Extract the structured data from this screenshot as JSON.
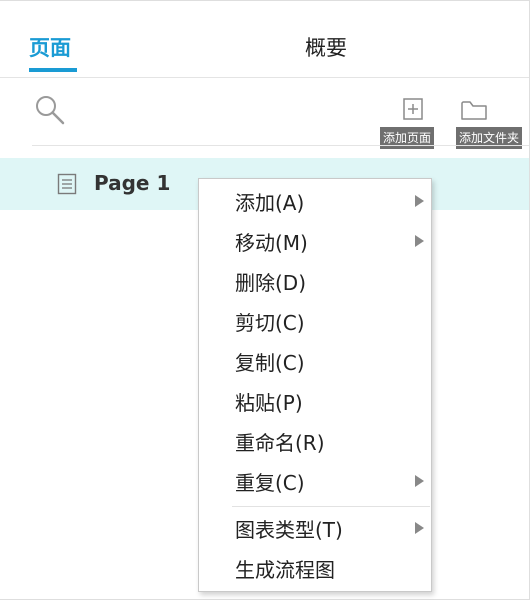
{
  "tabs": {
    "pages": "页面",
    "outline": "概要"
  },
  "toolbar": {
    "search_icon": "search-icon",
    "add_page_tooltip": "添加页面",
    "add_folder_tooltip": "添加文件夹"
  },
  "tree": {
    "items": [
      {
        "label": "Page 1",
        "icon": "page-icon",
        "selected": true
      }
    ]
  },
  "context_menu": {
    "items": [
      {
        "label": "添加(A)",
        "submenu": true
      },
      {
        "label": "移动(M)",
        "submenu": true
      },
      {
        "label": "删除(D)",
        "submenu": false
      },
      {
        "label": "剪切(C)",
        "submenu": false
      },
      {
        "label": "复制(C)",
        "submenu": false
      },
      {
        "label": "粘贴(P)",
        "submenu": false
      },
      {
        "label": "重命名(R)",
        "submenu": false
      },
      {
        "label": "重复(C)",
        "submenu": true
      },
      {
        "label": "图表类型(T)",
        "submenu": true
      },
      {
        "label": "生成流程图",
        "submenu": false
      }
    ]
  },
  "colors": {
    "accent": "#1a9bd4",
    "selected_row": "#dff6f6",
    "tooltip_bg": "#6f6f6f"
  }
}
